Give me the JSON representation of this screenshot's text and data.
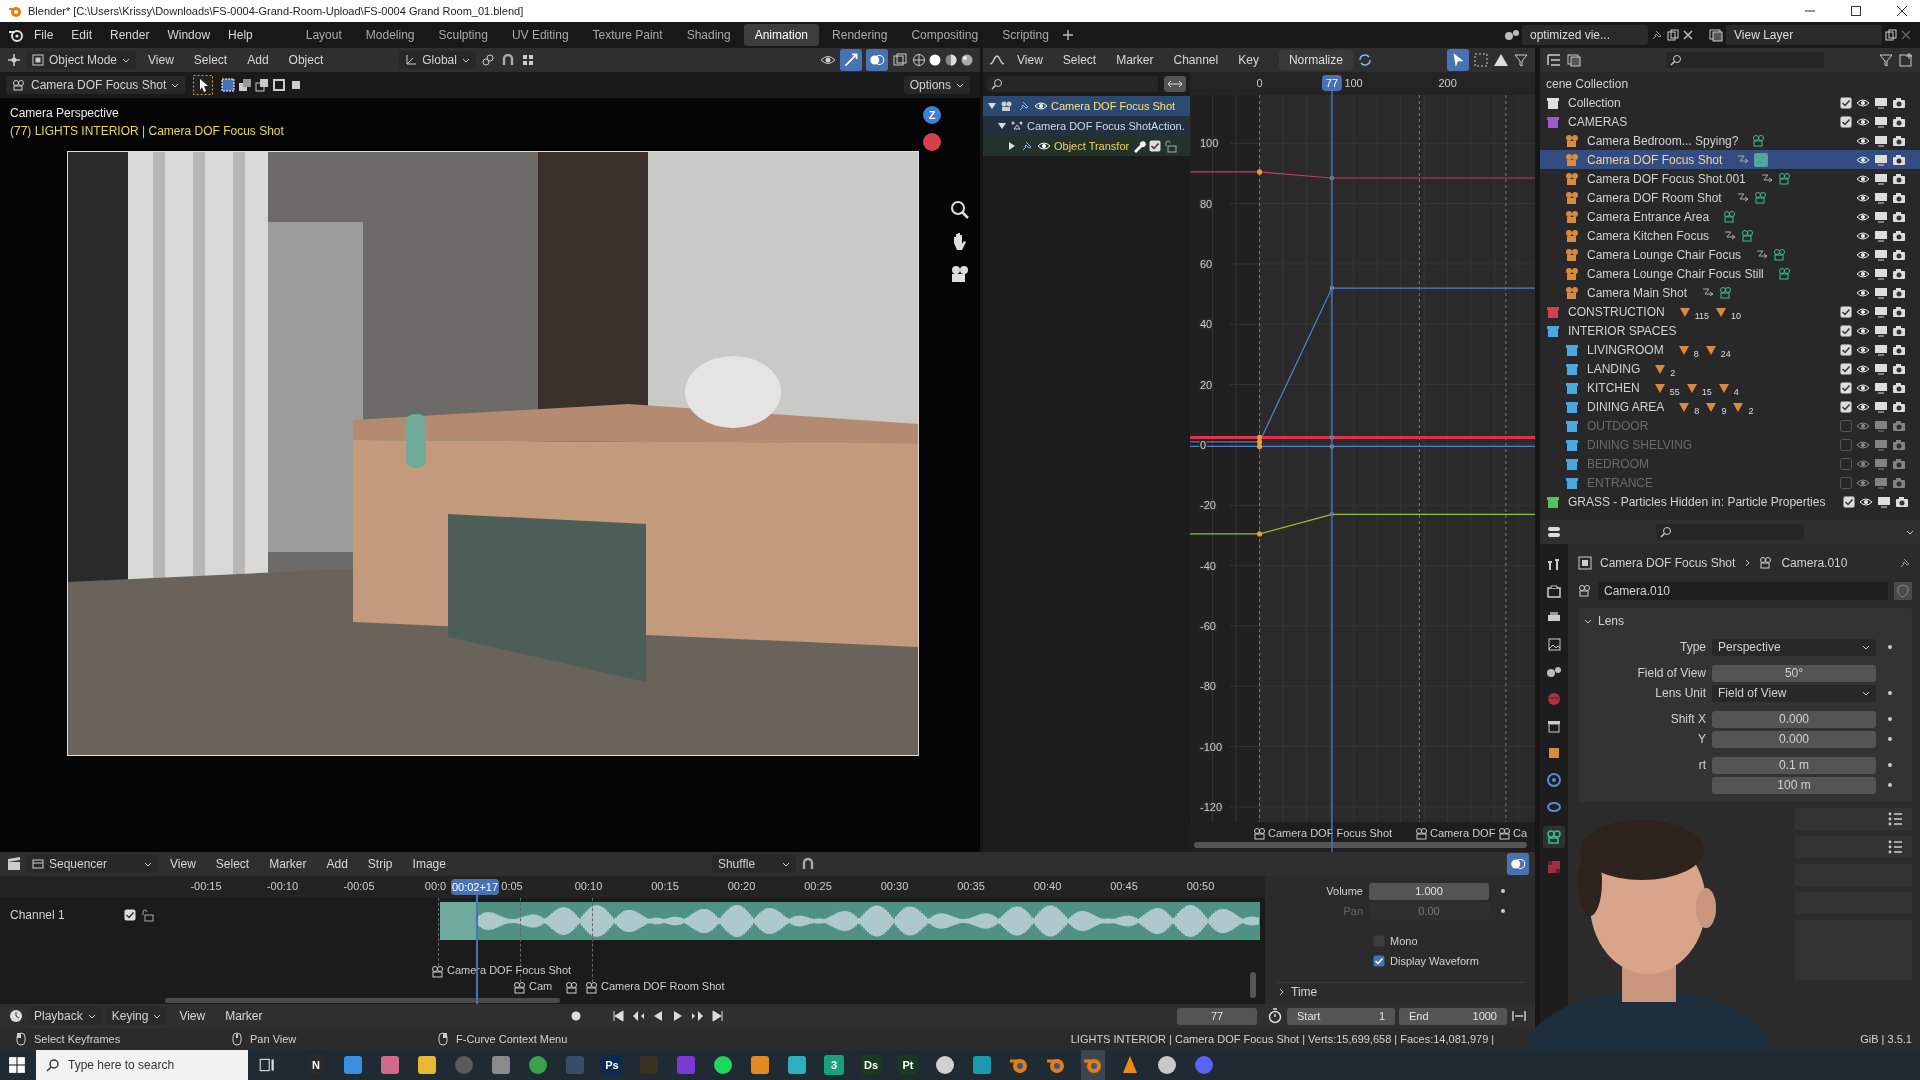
{
  "window": {
    "title": "Blender* [C:\\Users\\Krissy\\Downloads\\FS-0004-Grand-Room-Upload\\FS-0004 Grand Room_01.blend]"
  },
  "menu": [
    "File",
    "Edit",
    "Render",
    "Window",
    "Help"
  ],
  "workspaces": [
    {
      "label": "Layout",
      "selected": false
    },
    {
      "label": "Modeling",
      "selected": false
    },
    {
      "label": "Sculpting",
      "selected": false
    },
    {
      "label": "UV Editing",
      "selected": false
    },
    {
      "label": "Texture Paint",
      "selected": false
    },
    {
      "label": "Shading",
      "selected": false
    },
    {
      "label": "Animation",
      "selected": true
    },
    {
      "label": "Rendering",
      "selected": false
    },
    {
      "label": "Compositing",
      "selected": false
    },
    {
      "label": "Scripting",
      "selected": false
    }
  ],
  "scene": {
    "name": "optimized vie...",
    "view_layer": "View Layer"
  },
  "viewport": {
    "mode": "Object Mode",
    "menu": [
      "View",
      "Select",
      "Add",
      "Object"
    ],
    "orientation": "Global",
    "camera": "Camera DOF Focus Shot",
    "options": "Options",
    "overlay_title": "Camera Perspective",
    "overlay_info": "(77) LIGHTS INTERIOR | Camera DOF Focus Shot",
    "gizmo": [
      "Z"
    ]
  },
  "graph_editor": {
    "menu": [
      "View",
      "Select",
      "Marker",
      "Channel",
      "Key"
    ],
    "normalize": "Normalize",
    "channels": [
      {
        "label": "Camera DOF Focus Shot",
        "kind": "object",
        "selected": true,
        "expanded": true,
        "children": [
          {
            "label": "Camera DOF Focus ShotAction.",
            "kind": "action",
            "selected": false,
            "expanded": true,
            "children": [
              {
                "label": "Object Transfor",
                "kind": "group",
                "selected": false,
                "expanded": false
              }
            ]
          }
        ]
      }
    ],
    "chart_data": {
      "type": "line",
      "x": [
        -74,
        0,
        77,
        293
      ],
      "series": [
        {
          "color": "#c23a5c",
          "values": [
            90.5,
            90.5,
            88.5,
            88.5
          ]
        },
        {
          "color": "#4d7fd1",
          "values": [
            1,
            1,
            52,
            52
          ]
        },
        {
          "color": "#e0304e",
          "values": [
            2.5,
            2.5,
            2.5,
            2.5
          ]
        },
        {
          "color": "#4d7fd1",
          "values": [
            -0.5,
            -0.5,
            -0.5,
            -0.5
          ]
        },
        {
          "color": "#98bf3a",
          "values": [
            -29.5,
            -29.5,
            -23,
            -23
          ]
        }
      ],
      "xlim": [
        -74,
        293
      ],
      "ylim": [
        -125,
        116
      ],
      "xticks": [
        0,
        100,
        200
      ],
      "yticks": [
        100,
        80,
        60,
        40,
        20,
        0,
        -20,
        -40,
        -60,
        -80,
        -100,
        -120
      ],
      "grid": true,
      "ref_lines": [
        {
          "axis": "x",
          "value": 77,
          "label": "77"
        }
      ]
    },
    "markers": [
      "Camera DOF Focus Shot",
      "Camera DOF",
      "Ca"
    ]
  },
  "outliner": {
    "root": "cene Collection",
    "items": [
      {
        "label": "Collection",
        "kind": "collection",
        "color": "#e0e0e0",
        "checked": true,
        "selected": false
      },
      {
        "label": "CAMERAS",
        "kind": "collection",
        "color": "#9a5ad0",
        "checked": true,
        "selected": false,
        "children": [
          {
            "label": "Camera Bedroom... Spying?",
            "kind": "camera",
            "animated": false,
            "selected": false
          },
          {
            "label": "Camera DOF Focus Shot",
            "kind": "camera",
            "animated": true,
            "selected": true
          },
          {
            "label": "Camera DOF Focus Shot.001",
            "kind": "camera",
            "animated": true,
            "selected": false
          },
          {
            "label": "Camera DOF Room Shot",
            "kind": "camera",
            "animated": true,
            "selected": false
          },
          {
            "label": "Camera Entrance Area",
            "kind": "camera",
            "animated": false,
            "selected": false
          },
          {
            "label": "Camera Kitchen Focus",
            "kind": "camera",
            "animated": true,
            "selected": false
          },
          {
            "label": "Camera Lounge Chair Focus",
            "kind": "camera",
            "animated": true,
            "selected": false
          },
          {
            "label": "Camera Lounge Chair Focus Still",
            "kind": "camera",
            "animated": false,
            "selected": false
          },
          {
            "label": "Camera Main Shot",
            "kind": "camera",
            "animated": true,
            "selected": false
          }
        ]
      },
      {
        "label": "CONSTRUCTION",
        "kind": "collection",
        "color": "#d04050",
        "checked": true,
        "selected": false,
        "badges": [
          "115",
          "10"
        ]
      },
      {
        "label": "INTERIOR SPACES",
        "kind": "collection",
        "color": "#4aa8e0",
        "checked": true,
        "selected": false,
        "children": [
          {
            "label": "LIVINGROOM",
            "kind": "collection",
            "color": "#4aa8e0",
            "checked": true,
            "selected": false,
            "badges": [
              "8",
              "24"
            ]
          },
          {
            "label": "LANDING",
            "kind": "collection",
            "color": "#4aa8e0",
            "checked": true,
            "selected": false,
            "badges": [
              "2"
            ]
          },
          {
            "label": "KITCHEN",
            "kind": "collection",
            "color": "#4aa8e0",
            "checked": true,
            "selected": false,
            "badges": [
              "55",
              "15",
              "4"
            ]
          },
          {
            "label": "DINING AREA",
            "kind": "collection",
            "color": "#4aa8e0",
            "checked": true,
            "selected": false,
            "badges": [
              "8",
              "9",
              "2"
            ]
          },
          {
            "label": "OUTDOOR",
            "kind": "collection",
            "color": "#4aa8e0",
            "checked": false,
            "selected": false
          },
          {
            "label": "DINING SHELVING",
            "kind": "collection",
            "color": "#4aa8e0",
            "checked": false,
            "selected": false
          },
          {
            "label": "BEDROOM",
            "kind": "collection",
            "color": "#4aa8e0",
            "checked": false,
            "selected": false
          },
          {
            "label": "ENTRANCE",
            "kind": "collection",
            "color": "#4aa8e0",
            "checked": false,
            "selected": false
          }
        ]
      },
      {
        "label": "GRASS - Particles Hidden in: Particle Properties",
        "kind": "collection",
        "color": "#5ac05a",
        "checked": true,
        "selected": false
      }
    ]
  },
  "properties": {
    "breadcrumb": [
      "Camera DOF Focus Shot",
      "Camera.010"
    ],
    "datablock": "Camera.010",
    "panel": {
      "title": "Lens",
      "expanded": true,
      "groups": [
        [
          {
            "kind": "dropdown",
            "label": "Type",
            "value": "Perspective"
          }
        ],
        [
          {
            "kind": "number",
            "label": "Field of View",
            "value": "50°"
          },
          {
            "kind": "dropdown",
            "label": "Lens Unit",
            "value": "Field of View"
          }
        ],
        [
          {
            "kind": "number",
            "label": "Shift X",
            "value": "0.000"
          },
          {
            "kind": "number",
            "label": "Y",
            "value": "0.000"
          }
        ],
        [
          {
            "kind": "number",
            "label": "rt",
            "value": "0.1 m"
          },
          {
            "kind": "number",
            "value": "100 m"
          }
        ]
      ]
    }
  },
  "sequencer": {
    "editor": "Sequencer",
    "menu": [
      "View",
      "Select",
      "Marker",
      "Add",
      "Strip",
      "Image"
    ],
    "snap": "Shuffle",
    "ruler": [
      "-00:15",
      "-00:10",
      "-00:05",
      "00:0",
      "0:05",
      "00:10",
      "00:15",
      "00:20",
      "00:25",
      "00:30",
      "00:35",
      "00:40",
      "00:45",
      "00:50"
    ],
    "current_time": "00:02+17",
    "channel": {
      "label": "Channel 1",
      "checked": true
    },
    "markers": [
      "Camera DOF Focus Shot",
      "Cam",
      "Camera DOF Room Shot"
    ],
    "sidebar": {
      "volume_label": "Volume",
      "volume": "1.000",
      "pan_label": "Pan",
      "pan": "0.00",
      "pan_disabled": true,
      "toggles": [
        {
          "label": "Mono",
          "checked": false
        },
        {
          "label": "Display Waveform",
          "checked": true
        }
      ],
      "time_panel": "Time"
    }
  },
  "timeline": {
    "menus": [
      "Playback",
      "Keying",
      "View",
      "Marker"
    ],
    "frame": "77",
    "start_label": "Start",
    "start": "1",
    "end_label": "End",
    "end": "1000"
  },
  "status_bar": {
    "hints": [
      "Select Keyframes",
      "Pan View",
      "F-Curve Context Menu"
    ],
    "stats": "LIGHTS INTERIOR | Camera DOF Focus Shot | Verts:15,699,658 | Faces:14,081,979 |",
    "version": "GiB | 3.5.1"
  },
  "taskbar": {
    "search": {
      "placeholder": "Type here to search"
    },
    "apps": [
      {
        "kind": "glyph",
        "text": "N",
        "color": "#2a2a2a",
        "selected": false
      },
      {
        "kind": "tile",
        "color": "#3a8ee0",
        "selected": false
      },
      {
        "kind": "tile",
        "color": "#d06a8a",
        "selected": false
      },
      {
        "kind": "tile",
        "color": "#e8b830",
        "selected": false
      },
      {
        "kind": "circle",
        "color": "#5a5a5a",
        "selected": false
      },
      {
        "kind": "tile",
        "color": "#8a8a8a",
        "selected": false
      },
      {
        "kind": "circle",
        "color": "#3aa04a",
        "selected": false
      },
      {
        "kind": "tile",
        "color": "#3a4a6a",
        "selected": false
      },
      {
        "kind": "glyph",
        "text": "Ps",
        "color": "#0a2a50",
        "selected": false
      },
      {
        "kind": "tile",
        "color": "#3a3020",
        "selected": false
      },
      {
        "kind": "tile",
        "color": "#7a3ad0",
        "selected": false
      },
      {
        "kind": "circle",
        "color": "#1ed760",
        "selected": false
      },
      {
        "kind": "tile",
        "color": "#e08a20",
        "selected": false
      },
      {
        "kind": "tile",
        "color": "#2ab0c0",
        "selected": false
      },
      {
        "kind": "glyph",
        "text": "3",
        "color": "#1aa07a",
        "selected": false
      },
      {
        "kind": "glyph",
        "text": "Ds",
        "color": "#1a3a20",
        "selected": false
      },
      {
        "kind": "glyph",
        "text": "Pt",
        "color": "#1a3a20",
        "selected": false
      },
      {
        "kind": "circle",
        "color": "#d0d0d0",
        "selected": false
      },
      {
        "kind": "tile",
        "color": "#1a9ab0",
        "selected": false
      },
      {
        "kind": "blender",
        "color": "#e87d0d",
        "selected": false
      },
      {
        "kind": "blender",
        "color": "#e87d0d",
        "selected": false
      },
      {
        "kind": "blender",
        "color": "#e87d0d",
        "selected": true
      },
      {
        "kind": "cone",
        "color": "#f08a10",
        "selected": false
      },
      {
        "kind": "circle",
        "color": "#c8c8c8",
        "selected": false
      },
      {
        "kind": "circle",
        "color": "#5865f2",
        "selected": false
      }
    ]
  }
}
